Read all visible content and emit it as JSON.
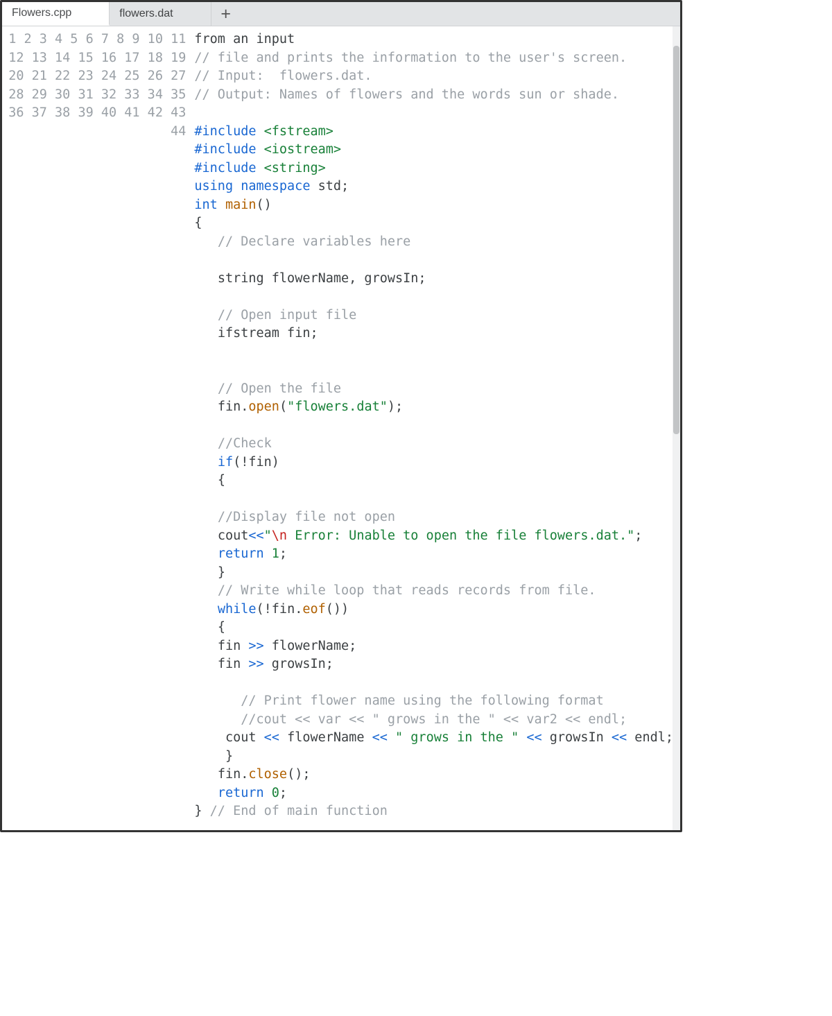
{
  "tabs": {
    "items": [
      {
        "label": "Flowers.cpp",
        "active": true
      },
      {
        "label": "flowers.dat",
        "active": false
      }
    ],
    "add_icon": "+"
  },
  "gutter": {
    "start": 1,
    "end": 44
  },
  "code": {
    "lines": [
      {
        "spans": [
          {
            "cls": "tok-ident",
            "text": "from an input"
          }
        ]
      },
      {
        "spans": [
          {
            "cls": "tok-comment",
            "text": "// file and prints the information to the user's screen."
          }
        ]
      },
      {
        "spans": [
          {
            "cls": "tok-comment",
            "text": "// Input:  flowers.dat."
          }
        ]
      },
      {
        "spans": [
          {
            "cls": "tok-comment",
            "text": "// Output: Names of flowers and the words sun or shade."
          }
        ]
      },
      {
        "spans": [
          {
            "cls": "",
            "text": ""
          }
        ]
      },
      {
        "spans": [
          {
            "cls": "tok-preproc",
            "text": "#include "
          },
          {
            "cls": "tok-include",
            "text": "<fstream>"
          }
        ]
      },
      {
        "spans": [
          {
            "cls": "tok-preproc",
            "text": "#include "
          },
          {
            "cls": "tok-include",
            "text": "<iostream>"
          }
        ]
      },
      {
        "spans": [
          {
            "cls": "tok-preproc",
            "text": "#include "
          },
          {
            "cls": "tok-include",
            "text": "<string>"
          }
        ]
      },
      {
        "spans": [
          {
            "cls": "tok-keyword",
            "text": "using "
          },
          {
            "cls": "tok-keyword",
            "text": "namespace "
          },
          {
            "cls": "tok-ident",
            "text": "std;"
          }
        ]
      },
      {
        "spans": [
          {
            "cls": "tok-type",
            "text": "int "
          },
          {
            "cls": "tok-func",
            "text": "main"
          },
          {
            "cls": "tok-ident",
            "text": "()"
          }
        ]
      },
      {
        "spans": [
          {
            "cls": "tok-ident",
            "text": "{"
          }
        ]
      },
      {
        "spans": [
          {
            "cls": "",
            "text": "   "
          },
          {
            "cls": "tok-comment",
            "text": "// Declare variables here"
          }
        ]
      },
      {
        "spans": [
          {
            "cls": "",
            "text": ""
          }
        ]
      },
      {
        "spans": [
          {
            "cls": "",
            "text": "   "
          },
          {
            "cls": "tok-ident",
            "text": "string flowerName, growsIn;"
          }
        ]
      },
      {
        "spans": [
          {
            "cls": "",
            "text": ""
          }
        ]
      },
      {
        "spans": [
          {
            "cls": "",
            "text": "   "
          },
          {
            "cls": "tok-comment",
            "text": "// Open input file"
          }
        ]
      },
      {
        "spans": [
          {
            "cls": "",
            "text": "   "
          },
          {
            "cls": "tok-ident",
            "text": "ifstream fin;"
          }
        ]
      },
      {
        "spans": [
          {
            "cls": "",
            "text": ""
          }
        ]
      },
      {
        "spans": [
          {
            "cls": "",
            "text": ""
          }
        ]
      },
      {
        "spans": [
          {
            "cls": "",
            "text": "   "
          },
          {
            "cls": "tok-comment",
            "text": "// Open the file"
          }
        ]
      },
      {
        "spans": [
          {
            "cls": "",
            "text": "   "
          },
          {
            "cls": "tok-ident",
            "text": "fin."
          },
          {
            "cls": "tok-func",
            "text": "open"
          },
          {
            "cls": "tok-ident",
            "text": "("
          },
          {
            "cls": "tok-string",
            "text": "\"flowers.dat\""
          },
          {
            "cls": "tok-ident",
            "text": ");"
          }
        ]
      },
      {
        "spans": [
          {
            "cls": "",
            "text": ""
          }
        ]
      },
      {
        "spans": [
          {
            "cls": "",
            "text": "   "
          },
          {
            "cls": "tok-comment",
            "text": "//Check"
          }
        ]
      },
      {
        "spans": [
          {
            "cls": "",
            "text": "   "
          },
          {
            "cls": "tok-keyword",
            "text": "if"
          },
          {
            "cls": "tok-ident",
            "text": "(!fin)"
          }
        ]
      },
      {
        "spans": [
          {
            "cls": "",
            "text": "   "
          },
          {
            "cls": "tok-ident",
            "text": "{"
          }
        ]
      },
      {
        "spans": [
          {
            "cls": "",
            "text": ""
          }
        ]
      },
      {
        "spans": [
          {
            "cls": "",
            "text": "   "
          },
          {
            "cls": "tok-comment",
            "text": "//Display file not open"
          }
        ]
      },
      {
        "spans": [
          {
            "cls": "",
            "text": "   "
          },
          {
            "cls": "tok-ident",
            "text": "cout"
          },
          {
            "cls": "tok-op",
            "text": "<<"
          },
          {
            "cls": "tok-string",
            "text": "\""
          },
          {
            "cls": "tok-escape",
            "text": "\\n"
          },
          {
            "cls": "tok-string",
            "text": " Error: Unable to open the file flowers.dat.\""
          },
          {
            "cls": "tok-ident",
            "text": ";"
          }
        ]
      },
      {
        "spans": [
          {
            "cls": "",
            "text": "   "
          },
          {
            "cls": "tok-keyword",
            "text": "return "
          },
          {
            "cls": "tok-number",
            "text": "1"
          },
          {
            "cls": "tok-ident",
            "text": ";"
          }
        ]
      },
      {
        "spans": [
          {
            "cls": "",
            "text": "   "
          },
          {
            "cls": "tok-ident",
            "text": "}"
          }
        ]
      },
      {
        "spans": [
          {
            "cls": "",
            "text": "   "
          },
          {
            "cls": "tok-comment",
            "text": "// Write while loop that reads records from file."
          }
        ]
      },
      {
        "spans": [
          {
            "cls": "",
            "text": "   "
          },
          {
            "cls": "tok-keyword",
            "text": "while"
          },
          {
            "cls": "tok-ident",
            "text": "(!fin."
          },
          {
            "cls": "tok-attr",
            "text": "eof"
          },
          {
            "cls": "tok-ident",
            "text": "())"
          }
        ]
      },
      {
        "spans": [
          {
            "cls": "",
            "text": "   "
          },
          {
            "cls": "tok-ident",
            "text": "{"
          }
        ]
      },
      {
        "spans": [
          {
            "cls": "",
            "text": "   "
          },
          {
            "cls": "tok-ident",
            "text": "fin "
          },
          {
            "cls": "tok-op",
            "text": ">>"
          },
          {
            "cls": "tok-ident",
            "text": " flowerName;"
          }
        ]
      },
      {
        "spans": [
          {
            "cls": "",
            "text": "   "
          },
          {
            "cls": "tok-ident",
            "text": "fin "
          },
          {
            "cls": "tok-op",
            "text": ">>"
          },
          {
            "cls": "tok-ident",
            "text": " growsIn;"
          }
        ]
      },
      {
        "spans": [
          {
            "cls": "",
            "text": ""
          }
        ]
      },
      {
        "spans": [
          {
            "cls": "",
            "text": "      "
          },
          {
            "cls": "tok-comment",
            "text": "// Print flower name using the following format"
          }
        ]
      },
      {
        "spans": [
          {
            "cls": "",
            "text": "      "
          },
          {
            "cls": "tok-comment",
            "text": "//cout << var << \" grows in the \" << var2 << endl;"
          }
        ]
      },
      {
        "spans": [
          {
            "cls": "",
            "text": "    "
          },
          {
            "cls": "tok-ident",
            "text": "cout "
          },
          {
            "cls": "tok-op",
            "text": "<<"
          },
          {
            "cls": "tok-ident",
            "text": " flowerName "
          },
          {
            "cls": "tok-op",
            "text": "<<"
          },
          {
            "cls": "tok-string",
            "text": " \" grows in the \" "
          },
          {
            "cls": "tok-op",
            "text": "<<"
          },
          {
            "cls": "tok-ident",
            "text": " growsIn "
          },
          {
            "cls": "tok-op",
            "text": "<<"
          },
          {
            "cls": "tok-ident",
            "text": " endl;"
          }
        ]
      },
      {
        "spans": [
          {
            "cls": "",
            "text": "    "
          },
          {
            "cls": "tok-ident",
            "text": "}"
          }
        ]
      },
      {
        "spans": [
          {
            "cls": "",
            "text": "   "
          },
          {
            "cls": "tok-ident",
            "text": "fin."
          },
          {
            "cls": "tok-func",
            "text": "close"
          },
          {
            "cls": "tok-ident",
            "text": "();"
          }
        ]
      },
      {
        "spans": [
          {
            "cls": "",
            "text": "   "
          },
          {
            "cls": "tok-keyword",
            "text": "return "
          },
          {
            "cls": "tok-number",
            "text": "0"
          },
          {
            "cls": "tok-ident",
            "text": ";"
          }
        ]
      },
      {
        "spans": [
          {
            "cls": "tok-ident",
            "text": "} "
          },
          {
            "cls": "tok-comment",
            "text": "// End of main function"
          }
        ]
      },
      {
        "spans": [
          {
            "cls": "",
            "text": ""
          }
        ]
      }
    ]
  }
}
